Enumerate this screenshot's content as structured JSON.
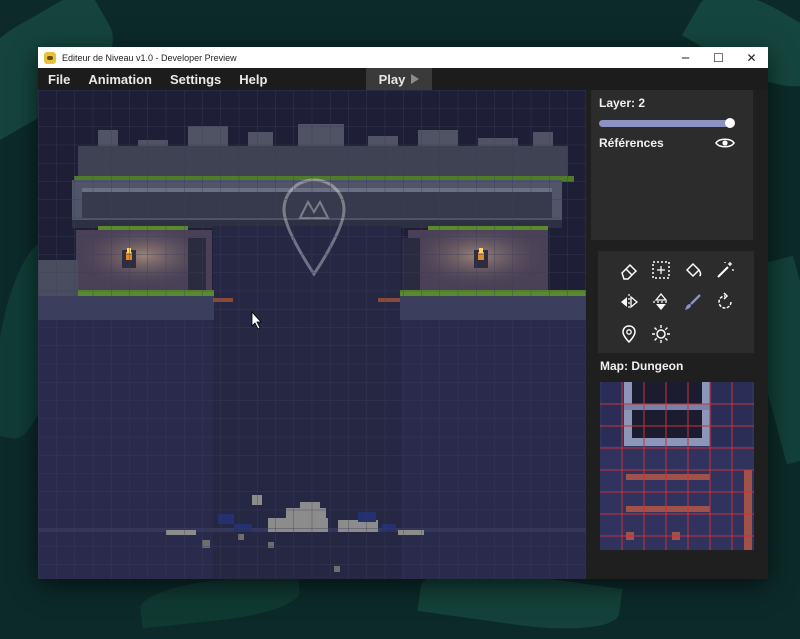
{
  "window": {
    "title": "Editeur de Niveau v1.0 - Developer Preview",
    "controls": [
      "─",
      "☐",
      "✕"
    ]
  },
  "menu": {
    "items": [
      "File",
      "Animation",
      "Settings",
      "Help"
    ],
    "play_label": "Play"
  },
  "layers_panel": {
    "layer_label": "Layer: 2",
    "slider_value_fraction": 1.0,
    "references_label": "Références"
  },
  "tools": [
    "eraser-icon",
    "select-icon",
    "fill-icon",
    "magic-wand-icon",
    "flip-horizontal-icon",
    "flip-vertical-icon",
    "brush-icon",
    "rotate-icon",
    "location-pin-icon",
    "light-icon"
  ],
  "map": {
    "label": "Map: Dungeon"
  },
  "colors": {
    "accent": "#8b93c4",
    "panel": "#2c2c2c",
    "canvas": "#1c1d33",
    "grid_red": "#c8323c"
  }
}
